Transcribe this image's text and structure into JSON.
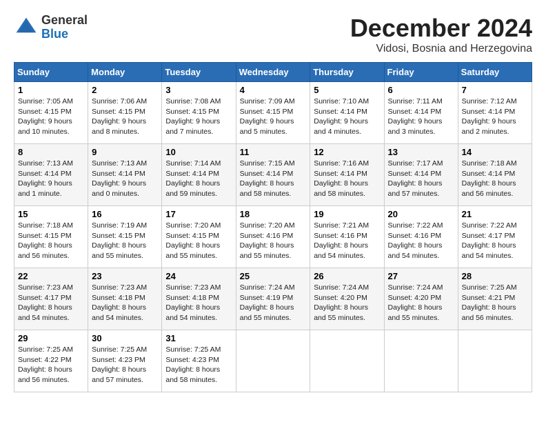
{
  "logo": {
    "general": "General",
    "blue": "Blue"
  },
  "title": "December 2024",
  "subtitle": "Vidosi, Bosnia and Herzegovina",
  "headers": [
    "Sunday",
    "Monday",
    "Tuesday",
    "Wednesday",
    "Thursday",
    "Friday",
    "Saturday"
  ],
  "weeks": [
    [
      {
        "day": "1",
        "sunrise": "7:05 AM",
        "sunset": "4:15 PM",
        "daylight": "9 hours and 10 minutes."
      },
      {
        "day": "2",
        "sunrise": "7:06 AM",
        "sunset": "4:15 PM",
        "daylight": "9 hours and 8 minutes."
      },
      {
        "day": "3",
        "sunrise": "7:08 AM",
        "sunset": "4:15 PM",
        "daylight": "9 hours and 7 minutes."
      },
      {
        "day": "4",
        "sunrise": "7:09 AM",
        "sunset": "4:15 PM",
        "daylight": "9 hours and 5 minutes."
      },
      {
        "day": "5",
        "sunrise": "7:10 AM",
        "sunset": "4:14 PM",
        "daylight": "9 hours and 4 minutes."
      },
      {
        "day": "6",
        "sunrise": "7:11 AM",
        "sunset": "4:14 PM",
        "daylight": "9 hours and 3 minutes."
      },
      {
        "day": "7",
        "sunrise": "7:12 AM",
        "sunset": "4:14 PM",
        "daylight": "9 hours and 2 minutes."
      }
    ],
    [
      {
        "day": "8",
        "sunrise": "7:13 AM",
        "sunset": "4:14 PM",
        "daylight": "9 hours and 1 minute."
      },
      {
        "day": "9",
        "sunrise": "7:13 AM",
        "sunset": "4:14 PM",
        "daylight": "9 hours and 0 minutes."
      },
      {
        "day": "10",
        "sunrise": "7:14 AM",
        "sunset": "4:14 PM",
        "daylight": "8 hours and 59 minutes."
      },
      {
        "day": "11",
        "sunrise": "7:15 AM",
        "sunset": "4:14 PM",
        "daylight": "8 hours and 58 minutes."
      },
      {
        "day": "12",
        "sunrise": "7:16 AM",
        "sunset": "4:14 PM",
        "daylight": "8 hours and 58 minutes."
      },
      {
        "day": "13",
        "sunrise": "7:17 AM",
        "sunset": "4:14 PM",
        "daylight": "8 hours and 57 minutes."
      },
      {
        "day": "14",
        "sunrise": "7:18 AM",
        "sunset": "4:14 PM",
        "daylight": "8 hours and 56 minutes."
      }
    ],
    [
      {
        "day": "15",
        "sunrise": "7:18 AM",
        "sunset": "4:15 PM",
        "daylight": "8 hours and 56 minutes."
      },
      {
        "day": "16",
        "sunrise": "7:19 AM",
        "sunset": "4:15 PM",
        "daylight": "8 hours and 55 minutes."
      },
      {
        "day": "17",
        "sunrise": "7:20 AM",
        "sunset": "4:15 PM",
        "daylight": "8 hours and 55 minutes."
      },
      {
        "day": "18",
        "sunrise": "7:20 AM",
        "sunset": "4:16 PM",
        "daylight": "8 hours and 55 minutes."
      },
      {
        "day": "19",
        "sunrise": "7:21 AM",
        "sunset": "4:16 PM",
        "daylight": "8 hours and 54 minutes."
      },
      {
        "day": "20",
        "sunrise": "7:22 AM",
        "sunset": "4:16 PM",
        "daylight": "8 hours and 54 minutes."
      },
      {
        "day": "21",
        "sunrise": "7:22 AM",
        "sunset": "4:17 PM",
        "daylight": "8 hours and 54 minutes."
      }
    ],
    [
      {
        "day": "22",
        "sunrise": "7:23 AM",
        "sunset": "4:17 PM",
        "daylight": "8 hours and 54 minutes."
      },
      {
        "day": "23",
        "sunrise": "7:23 AM",
        "sunset": "4:18 PM",
        "daylight": "8 hours and 54 minutes."
      },
      {
        "day": "24",
        "sunrise": "7:23 AM",
        "sunset": "4:18 PM",
        "daylight": "8 hours and 54 minutes."
      },
      {
        "day": "25",
        "sunrise": "7:24 AM",
        "sunset": "4:19 PM",
        "daylight": "8 hours and 55 minutes."
      },
      {
        "day": "26",
        "sunrise": "7:24 AM",
        "sunset": "4:20 PM",
        "daylight": "8 hours and 55 minutes."
      },
      {
        "day": "27",
        "sunrise": "7:24 AM",
        "sunset": "4:20 PM",
        "daylight": "8 hours and 55 minutes."
      },
      {
        "day": "28",
        "sunrise": "7:25 AM",
        "sunset": "4:21 PM",
        "daylight": "8 hours and 56 minutes."
      }
    ],
    [
      {
        "day": "29",
        "sunrise": "7:25 AM",
        "sunset": "4:22 PM",
        "daylight": "8 hours and 56 minutes."
      },
      {
        "day": "30",
        "sunrise": "7:25 AM",
        "sunset": "4:23 PM",
        "daylight": "8 hours and 57 minutes."
      },
      {
        "day": "31",
        "sunrise": "7:25 AM",
        "sunset": "4:23 PM",
        "daylight": "8 hours and 58 minutes."
      },
      null,
      null,
      null,
      null
    ]
  ],
  "labels": {
    "sunrise": "Sunrise:",
    "sunset": "Sunset:",
    "daylight": "Daylight:"
  }
}
